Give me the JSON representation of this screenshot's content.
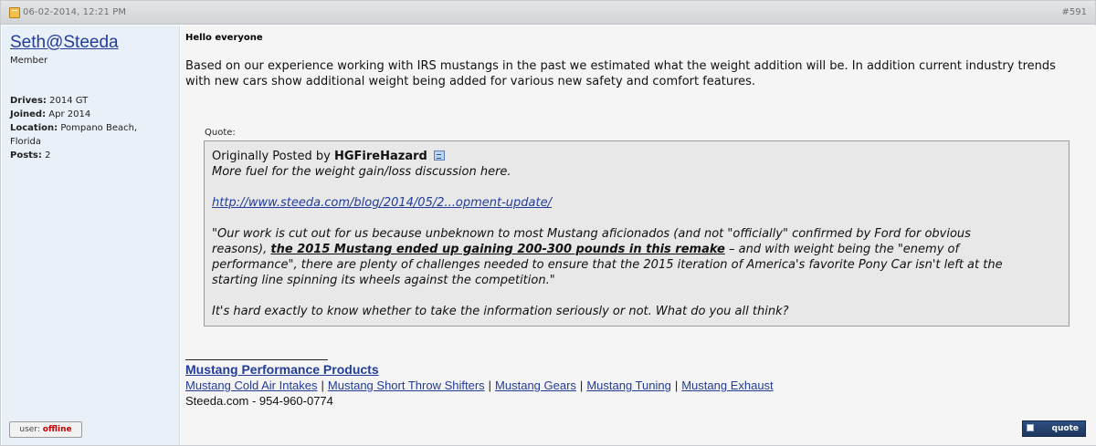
{
  "header": {
    "date": "06-02-2014, 12:21 PM",
    "post_number": "#591"
  },
  "user": {
    "name": "Seth@Steeda",
    "title": "Member",
    "info": [
      {
        "key": "Drives:",
        "value": "2014 GT"
      },
      {
        "key": "Joined:",
        "value": "Apr 2014"
      },
      {
        "key": "Location:",
        "value": "Pompano Beach, Florida"
      },
      {
        "key": "Posts:",
        "value": "2"
      }
    ],
    "status_prefix": "user:",
    "status": "offline",
    "status_color": "#cc0000"
  },
  "message": {
    "greeting": "Hello everyone",
    "body": "Based on our experience working with IRS mustangs in the past we estimated what the weight addition will be. In addition current industry trends with new cars show additional weight being added for various new safety and comfort features.",
    "quote_label": "Quote:",
    "quote": {
      "posted_by_prefix": "Originally Posted by",
      "author": "HGFireHazard",
      "line1": "More fuel for the weight gain/loss discussion here.",
      "link": "http://www.steeda.com/blog/2014/05/2...opment-update/",
      "para_line1": "\"Our work is cut out for us because unbeknown to most Mustang aficionados (and not \"officially\" confirmed by Ford for obvious",
      "para_line2_pre": "reasons), ",
      "para_line2_strong": "the 2015 Mustang ended up gaining 200-300 pounds in this remake",
      "para_line2_post": " – and with weight being the \"enemy of",
      "para_line3": "performance\", there are plenty of challenges needed to ensure that the 2015 iteration of America's favorite Pony Car isn't left at the",
      "para_line4": "starting line spinning its wheels against the competition.\"",
      "closing": "It's hard exactly to know whether to take the information seriously or not. What do you all think?"
    }
  },
  "signature": {
    "title": "Mustang Performance Products",
    "links": [
      "Mustang Cold Air Intakes",
      "Mustang Short Throw Shifters",
      "Mustang Gears",
      "Mustang Tuning",
      "Mustang Exhaust"
    ],
    "separator": "|",
    "contact": "Steeda.com - 954-960-0774"
  },
  "buttons": {
    "quote_label": "quote"
  },
  "colors": {
    "link": "#223c99",
    "user_panel_bg": "#eaf0f7",
    "quote_bg": "#e8e8e8",
    "quote_button_bg": "#1d365f"
  }
}
